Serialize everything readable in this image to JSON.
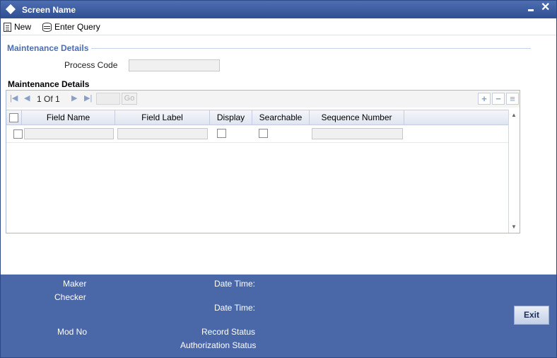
{
  "window": {
    "title": "Screen Name"
  },
  "toolbar": {
    "new_label": "New",
    "enter_query_label": "Enter Query"
  },
  "section": {
    "legend": "Maintenance Details"
  },
  "form": {
    "process_code_label": "Process Code",
    "process_code_value": ""
  },
  "grid": {
    "caption": "Maintenance Details",
    "pager": {
      "text": "1 Of 1",
      "go_label": "Go",
      "page_input": ""
    },
    "tools": {
      "add": "+",
      "remove": "−",
      "list": "≡"
    },
    "columns": [
      "Field Name",
      "Field Label",
      "Display",
      "Searchable",
      "Sequence Number"
    ],
    "rows": [
      {
        "field_name": "",
        "field_label": "",
        "display": false,
        "searchable": false,
        "sequence_number": ""
      }
    ]
  },
  "footer": {
    "maker_label": "Maker",
    "checker_label": "Checker",
    "date_time_label_1": "Date Time:",
    "date_time_label_2": "Date Time:",
    "mod_no_label": "Mod No",
    "record_status_label": "Record Status",
    "authorization_status_label": "Authorization Status",
    "exit_label": "Exit"
  },
  "colors": {
    "accent": "#4a68a8",
    "title_bar": "#2f4f93",
    "section_text": "#4c6db0"
  },
  "icons": [
    "diamond-icon",
    "minimize-icon",
    "close-icon",
    "new-icon",
    "enter-query-icon",
    "first-page-icon",
    "prev-page-icon",
    "next-page-icon",
    "last-page-icon",
    "add-row-icon",
    "delete-row-icon",
    "single-view-icon"
  ]
}
